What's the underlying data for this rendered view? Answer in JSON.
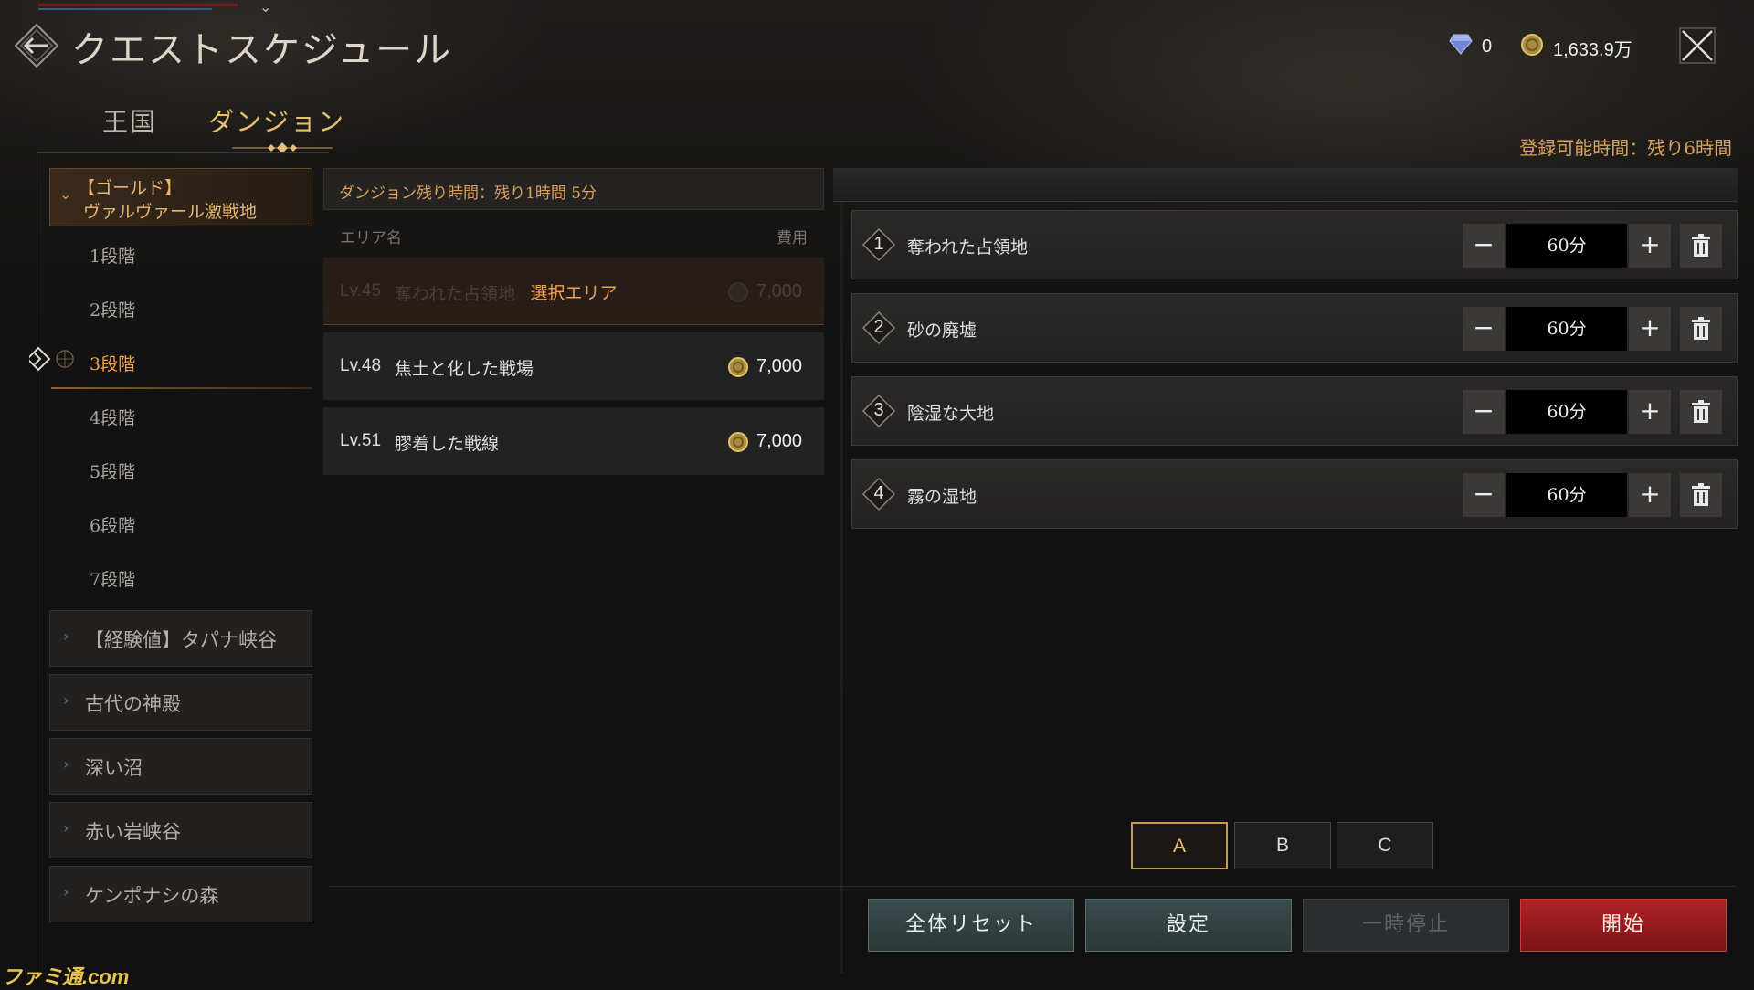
{
  "header": {
    "title": "クエストスケジュール",
    "gems": "0",
    "gold": "1,633.9万"
  },
  "tabs": [
    {
      "label": "王国"
    },
    {
      "label": "ダンジョン"
    }
  ],
  "registration_time": "登録可能時間：残り6時間",
  "sidebar": {
    "expanded_category": {
      "line1": "【ゴールド】",
      "line2": "ヴァルヴァール激戦地"
    },
    "stages": [
      "1段階",
      "2段階",
      "3段階",
      "4段階",
      "5段階",
      "6段階",
      "7段階"
    ],
    "active_stage": "3段階",
    "categories": [
      "【経験値】タパナ峡谷",
      "古代の神殿",
      "深い沼",
      "赤い岩峡谷",
      "ケンポナシの森"
    ]
  },
  "areas": {
    "remaining_time": "ダンジョン残り時間：残り1時間 5分",
    "col_name": "エリア名",
    "col_cost": "費用",
    "rows": [
      {
        "lv": "Lv.45",
        "name": "奪われた占領地",
        "cost": "7,000",
        "overlay": "選択エリア"
      },
      {
        "lv": "Lv.48",
        "name": "焦土と化した戦場",
        "cost": "7,000"
      },
      {
        "lv": "Lv.51",
        "name": "膠着した戦線",
        "cost": "7,000"
      }
    ]
  },
  "schedule": [
    {
      "num": "1",
      "name": "奪われた占領地",
      "time": "60分",
      "minus": "−",
      "plus": "+"
    },
    {
      "num": "2",
      "name": "砂の廃墟",
      "time": "60分",
      "minus": "−",
      "plus": "+"
    },
    {
      "num": "3",
      "name": "陰湿な大地",
      "time": "60分",
      "minus": "−",
      "plus": "+"
    },
    {
      "num": "4",
      "name": "霧の湿地",
      "time": "60分",
      "minus": "−",
      "plus": "+"
    }
  ],
  "presets": [
    "A",
    "B",
    "C"
  ],
  "active_preset": "A",
  "buttons": {
    "reset": "全体リセット",
    "setting": "設定",
    "pause": "一時停止",
    "start": "開始"
  },
  "watermark": "ファミ通.com",
  "colors": {
    "accent_gold": "#e6c26a",
    "accent_orange": "#f1a24a",
    "start_red": "#b02226",
    "teal_button": "#3a4b4b"
  },
  "icons": {
    "back": "back-arrow-icon",
    "gem": "diamond-icon",
    "gold": "gold-coin-icon",
    "close": "close-icon",
    "trash": "trash-icon"
  }
}
